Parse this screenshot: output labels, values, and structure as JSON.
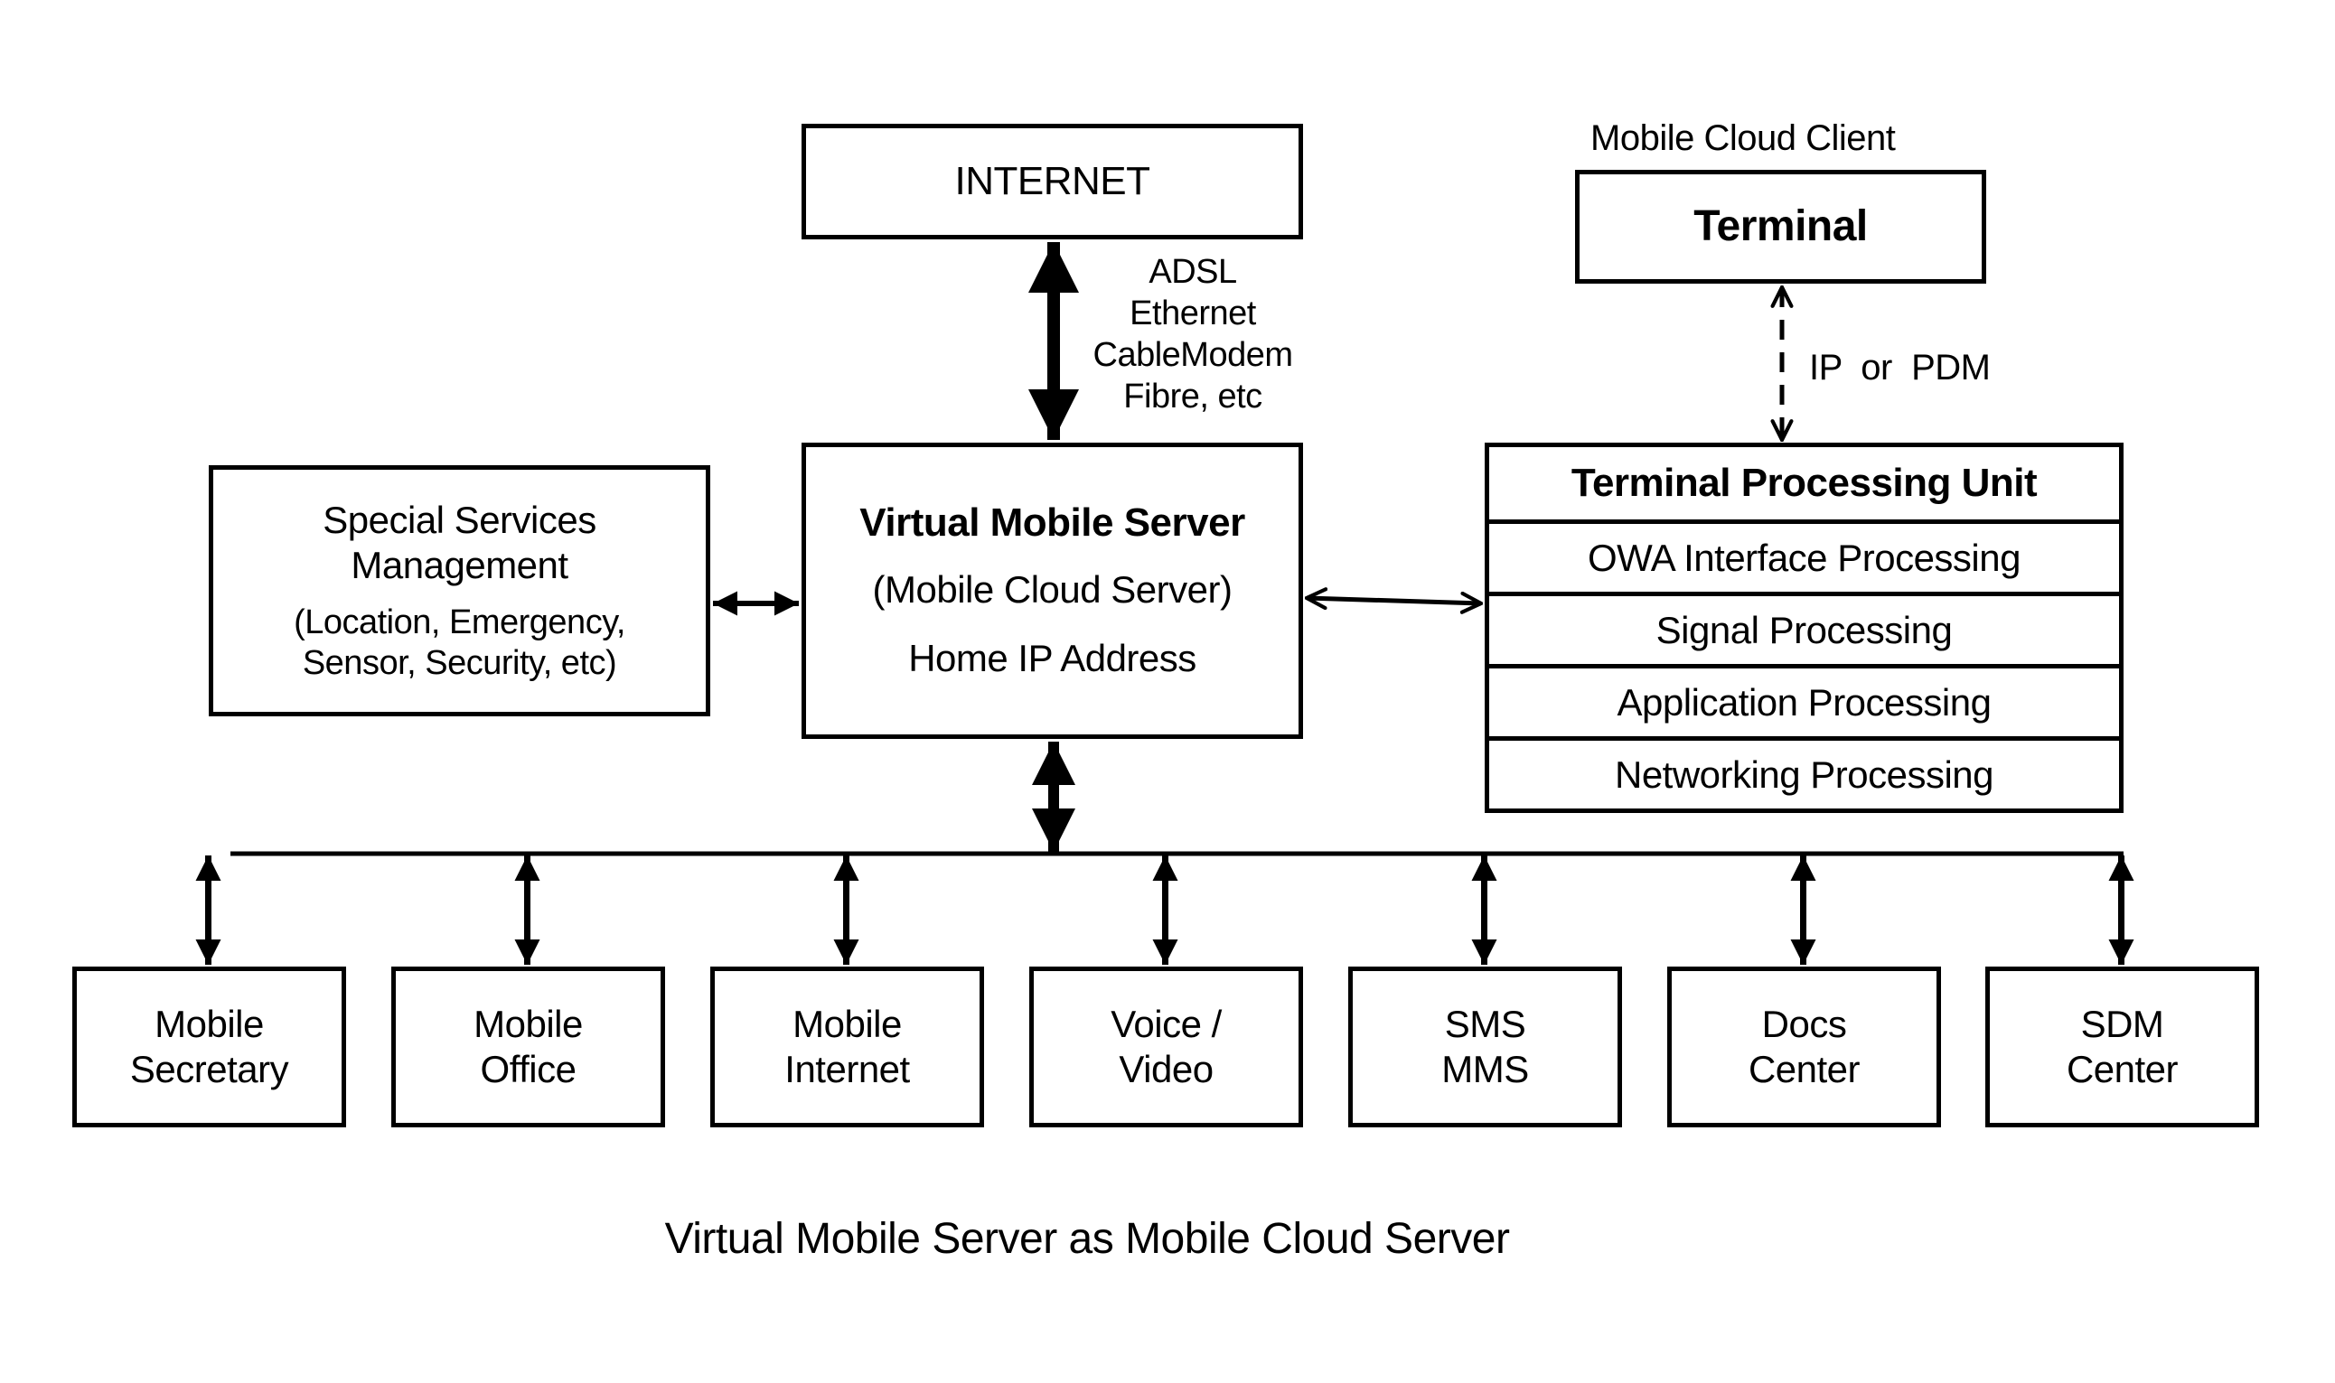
{
  "diagram": {
    "caption": "Virtual Mobile Server as Mobile Cloud Server",
    "internet": {
      "label": "INTERNET"
    },
    "internet_link": {
      "labels": [
        "ADSL",
        "Ethernet",
        "CableModem",
        "Fibre, etc"
      ]
    },
    "vms": {
      "title": "Virtual Mobile Server",
      "subtitle": "(Mobile Cloud Server)",
      "detail": "Home IP Address"
    },
    "special_services": {
      "line1": "Special Services",
      "line2": "Management",
      "line3": "(Location, Emergency,",
      "line4": "Sensor, Security, etc)"
    },
    "client": {
      "caption": "Mobile Cloud Client",
      "terminal": "Terminal",
      "link_label": "IP  or  PDM"
    },
    "tpu": {
      "title": "Terminal Processing Unit",
      "rows": [
        "OWA Interface Processing",
        "Signal Processing",
        "Application Processing",
        "Networking Processing"
      ]
    },
    "services": [
      {
        "line1": "Mobile",
        "line2": "Secretary"
      },
      {
        "line1": "Mobile",
        "line2": "Office"
      },
      {
        "line1": "Mobile",
        "line2": "Internet"
      },
      {
        "line1": "Voice /",
        "line2": "Video"
      },
      {
        "line1": "SMS",
        "line2": "MMS"
      },
      {
        "line1": "Docs",
        "line2": "Center"
      },
      {
        "line1": "SDM",
        "line2": "Center"
      }
    ]
  }
}
